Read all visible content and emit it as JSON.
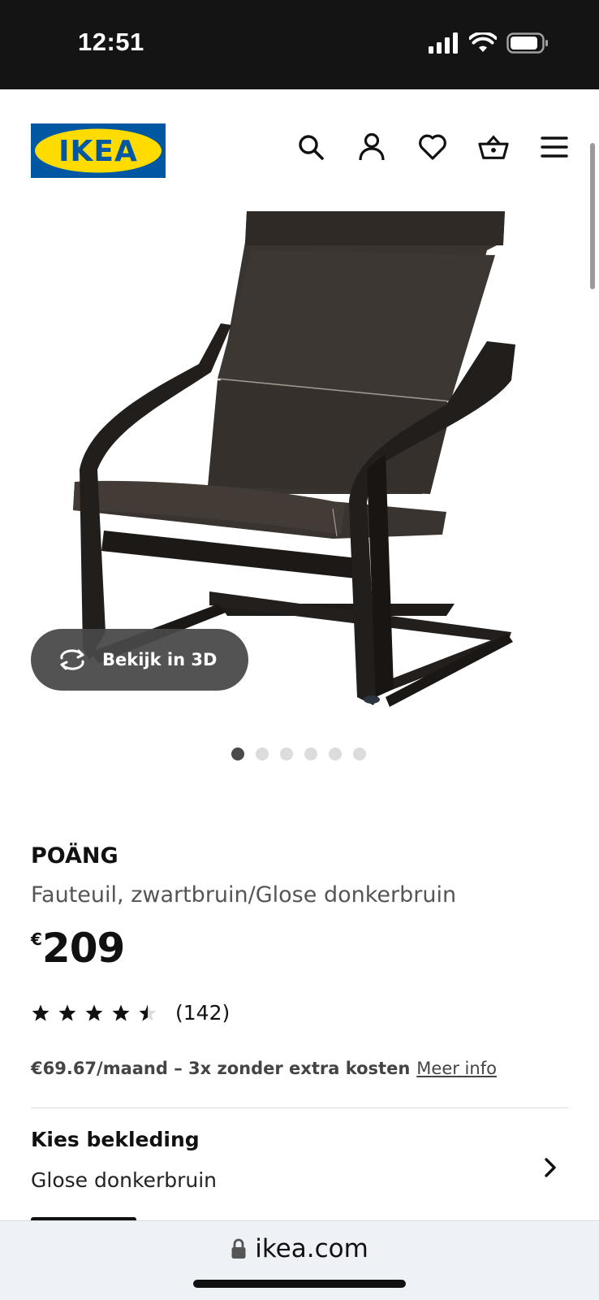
{
  "status_bar": {
    "time": "12:51"
  },
  "header": {
    "logo_text": "IKEA",
    "icons": [
      "search-icon",
      "account-icon",
      "wishlist-heart-icon",
      "cart-basket-icon",
      "menu-icon"
    ]
  },
  "gallery": {
    "view3d_label": "Bekijk in 3D",
    "slide_count": 6,
    "active_slide": 1
  },
  "product": {
    "name": "POÄNG",
    "description": "Fauteuil, zwartbruin/Glose donkerbruin",
    "price_currency": "€",
    "price": "209",
    "rating": 4.5,
    "rating_count": "(142)",
    "installment_text": "€69.67/maand – 3x zonder extra kosten",
    "installment_link": "Meer info"
  },
  "upholstery": {
    "title": "Kies bekleding",
    "value": "Glose donkerbruin"
  },
  "browser": {
    "url": "ikea.com"
  },
  "colors": {
    "ikea_blue": "#0058a3",
    "ikea_yellow": "#ffdb00",
    "chair_dark": "#2a2622"
  }
}
